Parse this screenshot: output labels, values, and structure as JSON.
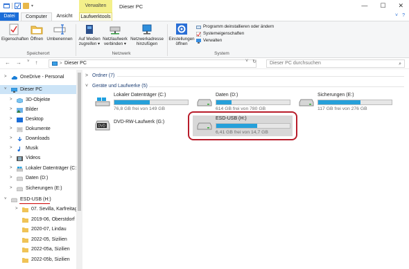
{
  "titlebar": {
    "manage_tab": "Verwalten",
    "window_title": "Dieser PC",
    "minimize": "—",
    "maximize": "☐",
    "close": "✕"
  },
  "tabs": {
    "datei": "Datei",
    "computer": "Computer",
    "ansicht": "Ansicht",
    "laufwerktools": "Laufwerktools",
    "expand": "˅",
    "help": "?"
  },
  "ribbon": {
    "eigenschaften": "Eigenschaften",
    "oeffnen": "Öffnen",
    "umbenennen": "Umbenennen",
    "speicherort_label": "Speicherort",
    "auf_medien": "Auf Medien",
    "zugreifen": "zugreifen ▾",
    "netzlaufwerk": "Netzlaufwerk",
    "verbinden": "verbinden ▾",
    "netzwerkadresse": "Netzwerkadresse",
    "hinzufuegen": "hinzufügen",
    "netzwerk_label": "Netzwerk",
    "einstellungen": "Einstellungen",
    "oeffnen2": "öffnen",
    "programm_deinstallieren": "Programm deinstallieren oder ändern",
    "systemeigenschaften": "Systemeigenschaften",
    "verwalten": "Verwalten",
    "system_label": "System"
  },
  "addressbar": {
    "back": "←",
    "forward": "→",
    "recent": "˅",
    "up": "↑",
    "separator": ">",
    "path": "Dieser PC",
    "dropdown": "˅",
    "refresh": "↻",
    "search_placeholder": "Dieser PC durchsuchen",
    "search_icon": "⌕"
  },
  "navpane": {
    "items": [
      {
        "label": "OneDrive - Personal",
        "chev": ">"
      },
      {
        "label": "Dieser PC",
        "chev": "˅"
      },
      {
        "label": "3D-Objekte",
        "chev": ">"
      },
      {
        "label": "Bilder",
        "chev": ">"
      },
      {
        "label": "Desktop",
        "chev": ">"
      },
      {
        "label": "Dokumente",
        "chev": ">"
      },
      {
        "label": "Downloads",
        "chev": ">"
      },
      {
        "label": "Musik",
        "chev": ">"
      },
      {
        "label": "Videos",
        "chev": ">"
      },
      {
        "label": "Lokaler Datenträger (C:)",
        "chev": ">"
      },
      {
        "label": "Daten (D:)",
        "chev": ">"
      },
      {
        "label": "Sicherungen (E:)",
        "chev": ">"
      },
      {
        "label": "ESD-USB (H:)",
        "chev": "˅"
      },
      {
        "label": "07. Sevilla, Karfreitag Aben",
        "chev": ">"
      },
      {
        "label": "2019-06, Oberstdorf",
        "chev": ""
      },
      {
        "label": "2020-07, Lindau",
        "chev": ""
      },
      {
        "label": "2022-05, Sizilien",
        "chev": ""
      },
      {
        "label": "2022-05a, Sizilien",
        "chev": ""
      },
      {
        "label": "2022-05b, Sizilien",
        "chev": ""
      }
    ]
  },
  "content": {
    "folders_section": "Ordner (7)",
    "drives_section": "Geräte und Laufwerke (5)",
    "folders_chev": ">",
    "drives_chev": "˅",
    "drives": [
      {
        "name": "Lokaler Datenträger (C:)",
        "free": "76,8 GB frei von 149 GB",
        "used_fraction": 0.48
      },
      {
        "name": "Daten (D:)",
        "free": "614 GB frei von 780 GB",
        "used_fraction": 0.21
      },
      {
        "name": "Sicherungen (E:)",
        "free": "117 GB frei von 276 GB",
        "used_fraction": 0.58
      },
      {
        "name": "DVD-RW-Laufwerk (G:)",
        "free": "",
        "used_fraction": null
      },
      {
        "name": "ESD-USB (H:)",
        "free": "6,41 GB frei von 14,7 GB",
        "used_fraction": 0.56
      }
    ],
    "dvd_label": "DVD"
  },
  "colors": {
    "accent": "#1a6dd8",
    "bar_fill": "#26a0da",
    "highlight": "#b81c2a",
    "selection": "#cce4f7",
    "manage_tab": "#f4f08a"
  }
}
